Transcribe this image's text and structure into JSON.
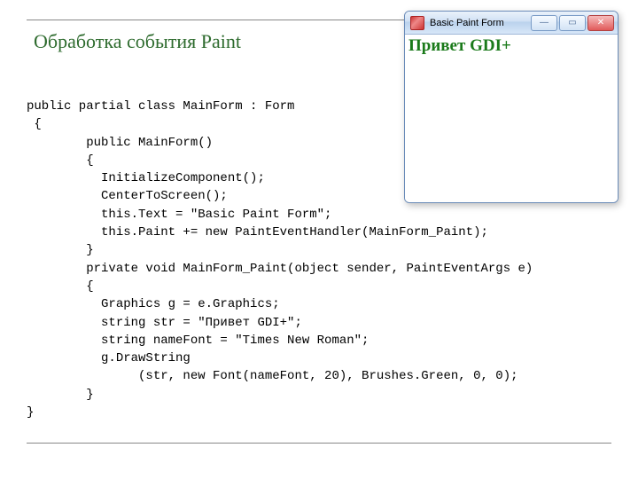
{
  "title": "Обработка события Paint",
  "code_lines": [
    "public partial class MainForm : Form",
    " {",
    "        public MainForm()",
    "        {",
    "          InitializeComponent();",
    "          CenterToScreen();",
    "          this.Text = \"Basic Paint Form\";",
    "          this.Paint += new PaintEventHandler(MainForm_Paint);",
    "        }",
    "        private void MainForm_Paint(object sender, PaintEventArgs e)",
    "        {",
    "          Graphics g = e.Graphics;",
    "          string str = \"Привет GDI+\";",
    "          string nameFont = \"Times New Roman\";",
    "          g.DrawString",
    "               (str, new Font(nameFont, 20), Brushes.Green, 0, 0);",
    "        }",
    "}"
  ],
  "window": {
    "title": "Basic Paint Form",
    "drawn_text": "Привет GDI+",
    "buttons": {
      "minimize_glyph": "—",
      "maximize_glyph": "▭",
      "close_glyph": "✕"
    }
  }
}
